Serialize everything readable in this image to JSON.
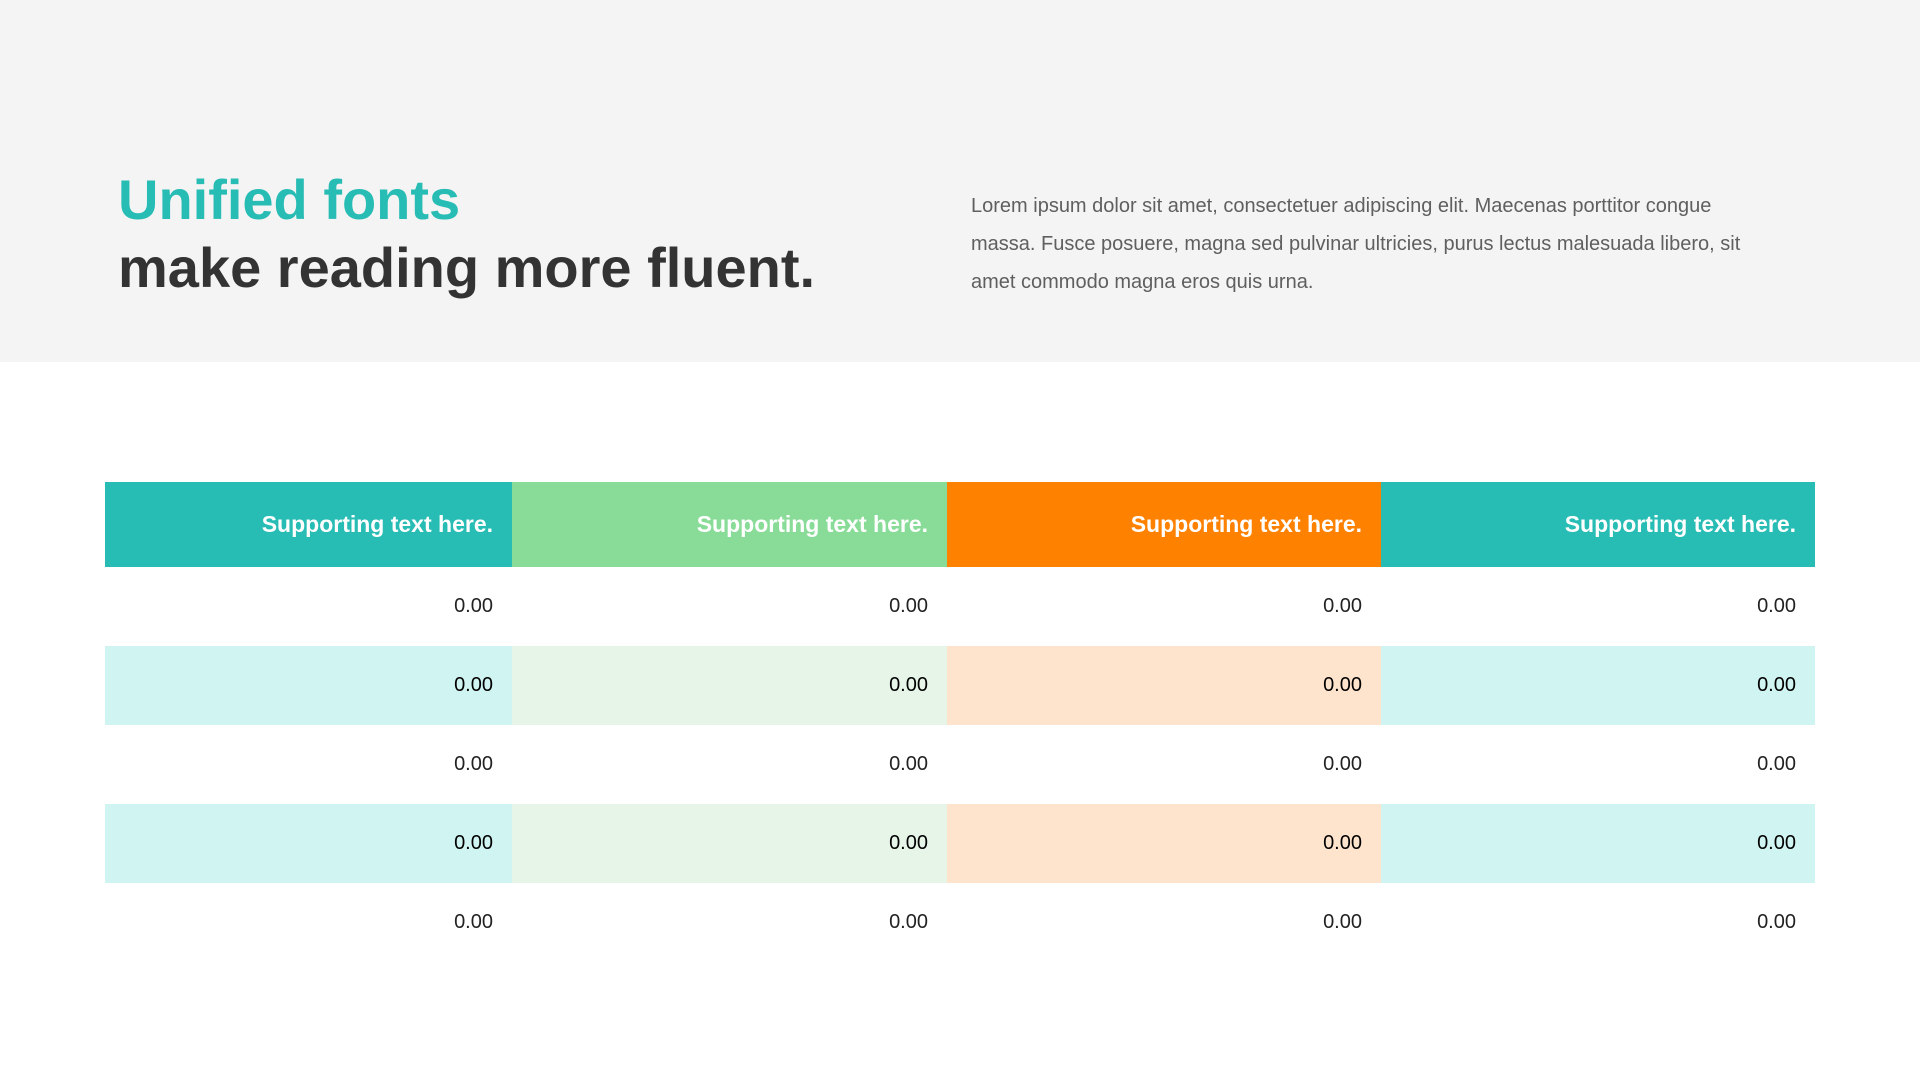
{
  "slide": {
    "title_accent": "Unified fonts",
    "title_main": "make reading more fluent.",
    "description": "Lorem ipsum dolor sit amet, consectetuer adipiscing elit. Maecenas porttitor congue massa. Fusce posuere, magna sed pulvinar ultricies, purus lectus malesuada libero, sit amet commodo magna eros quis urna."
  },
  "colors": {
    "hero_background": "#f4f4f4",
    "accent_teal": "#27bcb4",
    "title_dark": "#333333",
    "body_text": "#5f5f5f",
    "column_header_colors": [
      "#27bcb4",
      "#88dc97",
      "#ff8100",
      "#27bcb4"
    ],
    "column_tint_colors": [
      "#d0f4f2",
      "#e6f5e8",
      "#ffe4cd",
      "#d0f4f2"
    ]
  },
  "table": {
    "headers": [
      "Supporting text here.",
      "Supporting text here.",
      "Supporting text here.",
      "Supporting text here."
    ],
    "rows": [
      [
        "0.00",
        "0.00",
        "0.00",
        "0.00"
      ],
      [
        "0.00",
        "0.00",
        "0.00",
        "0.00"
      ],
      [
        "0.00",
        "0.00",
        "0.00",
        "0.00"
      ],
      [
        "0.00",
        "0.00",
        "0.00",
        "0.00"
      ],
      [
        "0.00",
        "0.00",
        "0.00",
        "0.00"
      ]
    ],
    "shaded_rows": [
      false,
      true,
      false,
      true,
      false
    ]
  }
}
